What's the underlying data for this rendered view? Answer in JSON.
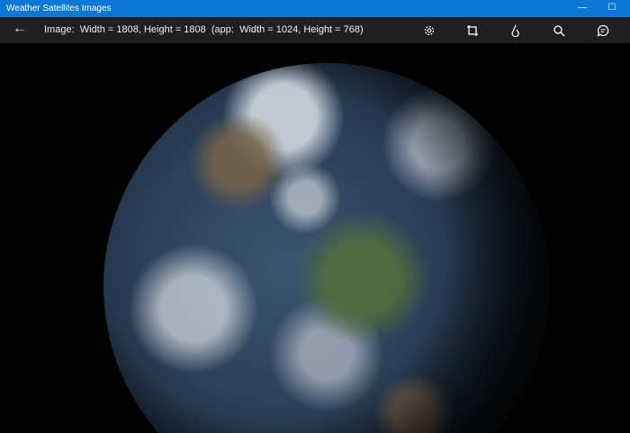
{
  "window": {
    "title": "Weather Satellites Images",
    "minimize_icon": "minimize-icon",
    "maximize_icon": "maximize-icon"
  },
  "toolbar": {
    "info": "Image:  Width = 1808, Height = 1808  (app:  Width = 1024, Height = 768)",
    "icons": [
      "back-arrow-icon",
      "gear-icon",
      "crop-icon",
      "touch-icon",
      "search-icon",
      "chat-icon"
    ]
  },
  "viewer": {
    "image": "satellite-earth-image"
  }
}
